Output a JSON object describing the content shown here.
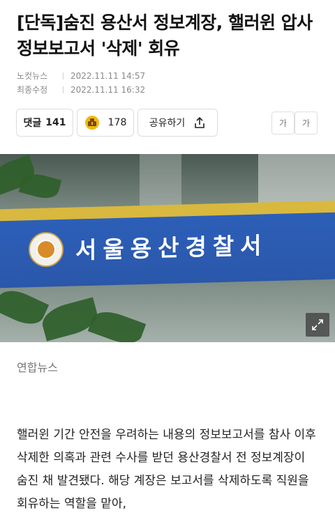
{
  "article": {
    "title": "[단독]숨진 용산서 정보계장, 핼러윈 압사 정보보고서 '삭제' 회유",
    "source_label": "노컷뉴스",
    "published": "2022.11.11 14:57",
    "modified_label": "최종수정",
    "modified": "2022.11.11 16:32"
  },
  "actions": {
    "comment_label": "댓글",
    "comment_count": "141",
    "reaction_count": "178",
    "share_label": "공유하기",
    "font_small": "가",
    "font_large": "가"
  },
  "photo": {
    "sign_text": "서울용산경찰서",
    "credit": "연합뉴스"
  },
  "body": {
    "paragraph": "핼러윈 기간 안전을 우려하는 내용의 정보보고서를 참사 이후 삭제한 의혹과 관련 수사를 받던 용산경찰서 전 정보계장이 숨진 채 발견됐다. 해당 계장은 보고서를 삭제하도록 직원을 회유하는 역할을 맡아,"
  },
  "colors": {
    "sign_blue": "#2d5fb8",
    "sign_yellow": "#d8b83e",
    "reaction_yellow": "#f1b80f"
  }
}
